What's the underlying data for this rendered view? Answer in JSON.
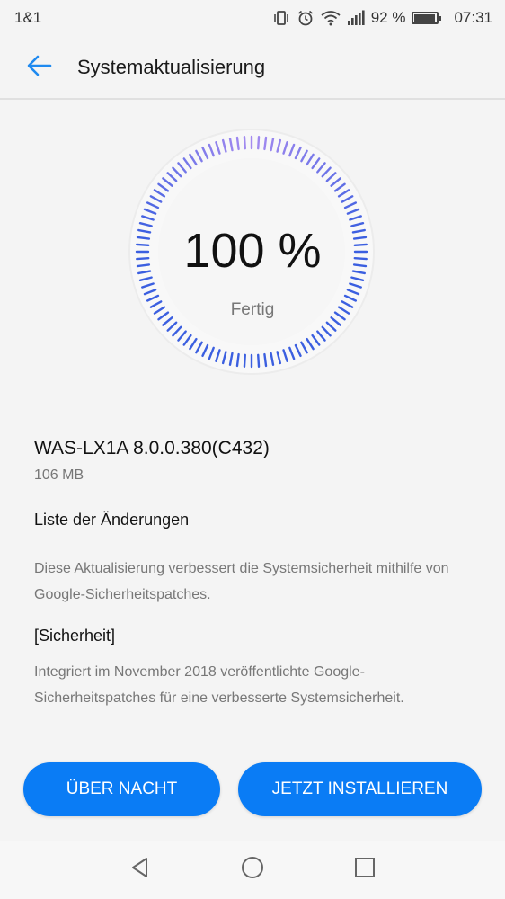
{
  "status_bar": {
    "carrier": "1&1",
    "battery_text": "92 %",
    "battery_level": 0.92,
    "time": "07:31",
    "icons": [
      "vibrate-icon",
      "alarm-icon",
      "wifi-icon",
      "signal-icon",
      "battery-icon"
    ]
  },
  "header": {
    "title": "Systemaktualisierung",
    "back_icon": "arrow-left-icon"
  },
  "progress": {
    "value_text": "100 %",
    "status": "Fertig",
    "fraction": 1.0,
    "colors": {
      "start": "#3b5fe0",
      "end": "#a58bf0",
      "track": "#e6e6e6"
    }
  },
  "update": {
    "version": "WAS-LX1A 8.0.0.380(C432)",
    "size": "106 MB",
    "changes_title": "Liste der Änderungen",
    "changes_text": "Diese Aktualisierung verbessert die Systemsicherheit mithilfe von Google-Sicherheitspatches.",
    "security_title": "[Sicherheit]",
    "security_text": "Integriert im November 2018 veröffentlichte Google-Sicherheitspatches für eine verbesserte Systemsicherheit."
  },
  "actions": {
    "later_label": "ÜBER NACHT",
    "install_label": "JETZT INSTALLIEREN",
    "accent": "#0a7cf5"
  },
  "nav": {
    "icons": [
      "nav-back-icon",
      "nav-home-icon",
      "nav-recents-icon"
    ]
  }
}
